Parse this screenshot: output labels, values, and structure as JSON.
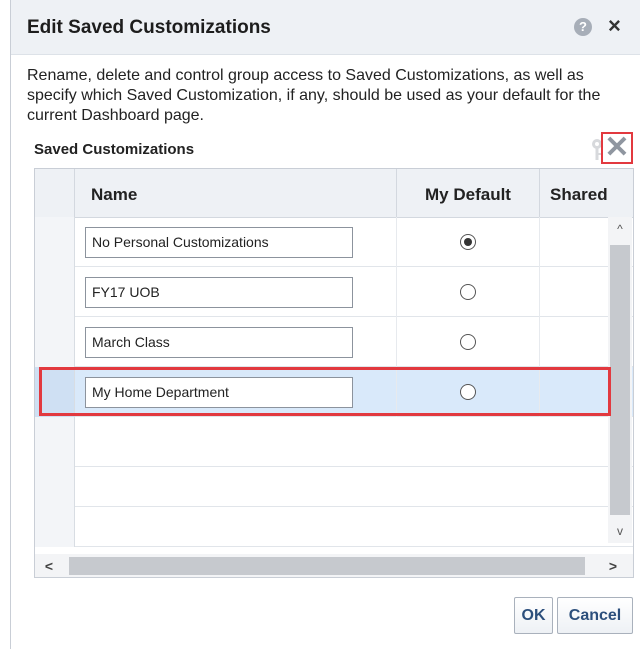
{
  "dialog": {
    "title": "Edit Saved Customizations",
    "help_icon": "?",
    "close_icon": "×"
  },
  "description": "Rename, delete and control group access to Saved Customizations, as well as specify which Saved Customization, if any, should be used as your default for the current Dashboard page.",
  "section_label": "Saved Customizations",
  "toolbar": {
    "delete_icon": "✕"
  },
  "table": {
    "columns": [
      "Name",
      "My Default",
      "Shared"
    ],
    "rows": [
      {
        "name": "No Personal Customizations",
        "default": true
      },
      {
        "name": "FY17 UOB",
        "default": false
      },
      {
        "name": "March Class",
        "default": false
      },
      {
        "name": "My Home Department",
        "default": false,
        "selected": true
      }
    ]
  },
  "scrollbar": {
    "up": "^",
    "down": "v",
    "left": "<",
    "right": ">"
  },
  "buttons": {
    "ok": "OK",
    "cancel": "Cancel"
  },
  "colors": {
    "highlight": "#e2393f",
    "selected_row": "#d9e9fa",
    "button_text": "#2c4f7c"
  }
}
